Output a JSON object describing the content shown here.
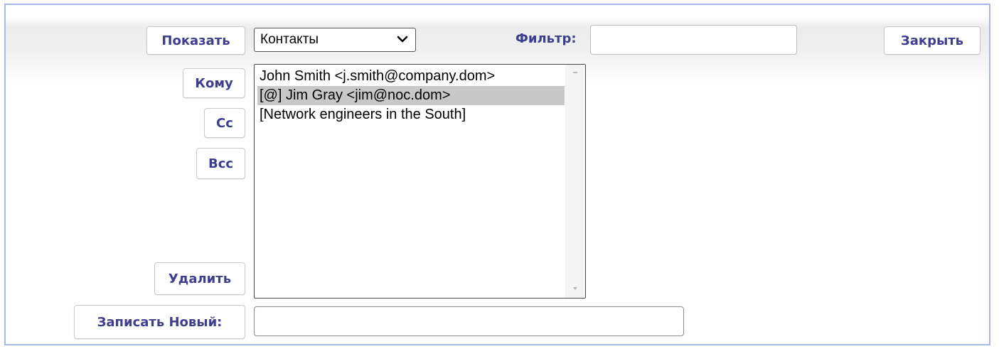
{
  "toolbar": {
    "show_label": "Показать",
    "source_select": {
      "selected": "Контакты",
      "options": [
        "Контакты"
      ]
    },
    "filter_label": "Фильтр:",
    "filter_value": "",
    "close_label": "Закрыть"
  },
  "recipients": {
    "to_label": "Кому",
    "cc_label": "Cc",
    "bcc_label": "Bcc",
    "delete_label": "Удалить"
  },
  "contact_list": {
    "items": [
      {
        "text": "John Smith <j.smith@company.dom>",
        "selected": false
      },
      {
        "text": "[@] Jim Gray <jim@noc.dom>",
        "selected": true
      },
      {
        "text": "[Network engineers in the South]",
        "selected": false
      }
    ]
  },
  "new_entry": {
    "label": "Записать Новый:",
    "value": ""
  },
  "colors": {
    "button_text": "#3e3e8e",
    "frame_border": "#a9b7e6",
    "selection_bg": "#c8c8c8"
  }
}
